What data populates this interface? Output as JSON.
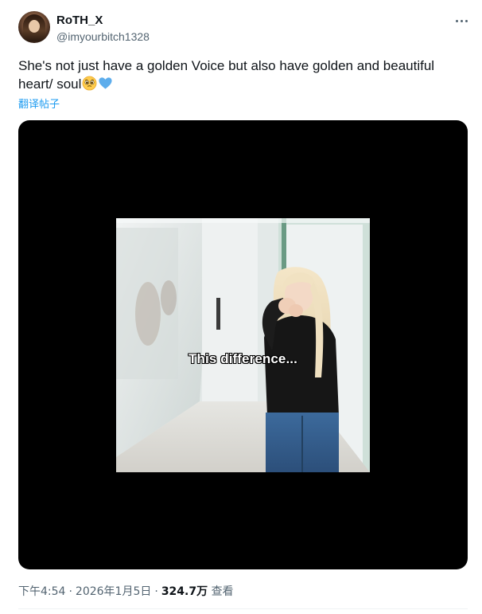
{
  "author": {
    "display_name": "RoTH_X",
    "handle": "@imyourbitch1328"
  },
  "tweet": {
    "text": "She's not just have a golden Voice but also have golden and beautiful heart/ soul",
    "emojis": [
      "pleading-face-emoji",
      "blue-heart-emoji"
    ],
    "translate_label": "翻译帖子"
  },
  "media": {
    "caption": "This difference..."
  },
  "meta": {
    "time": "下午4:54",
    "separator": "·",
    "date": "2026年1月5日",
    "views_count": "324.7万",
    "views_label": "查看"
  },
  "colors": {
    "accent": "#1d9bf0",
    "text": "#0f1419",
    "secondary": "#536471",
    "media_bg": "#000000"
  }
}
